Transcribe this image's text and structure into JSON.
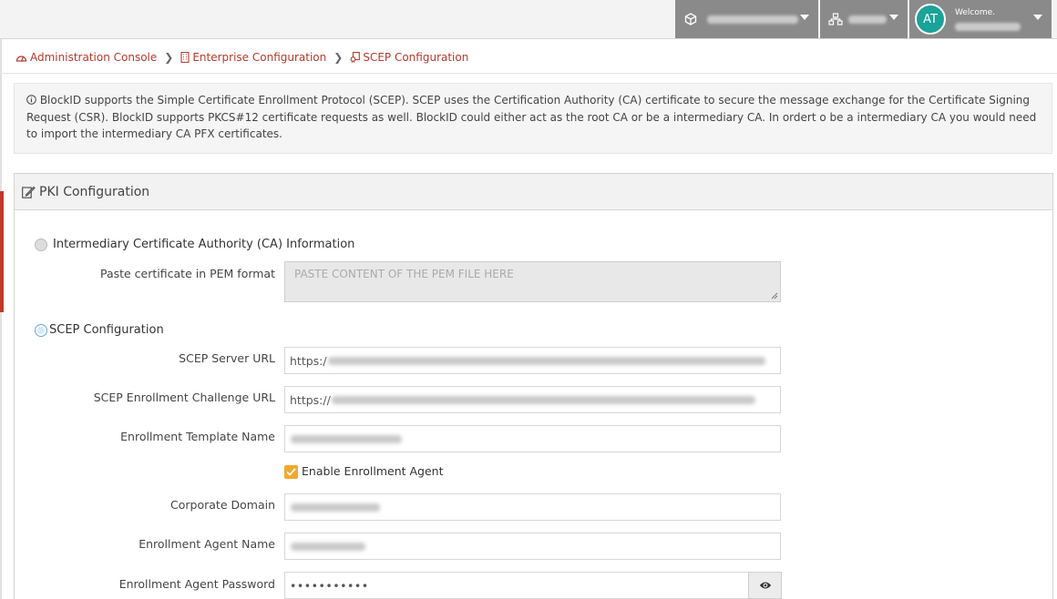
{
  "topbar": {
    "tenant_icon": "cube-icon",
    "network_icon": "network-icon",
    "avatar_initials": "AT",
    "welcome_label": "Welcome."
  },
  "breadcrumb": [
    {
      "label": "Administration Console",
      "icon": "dashboard-icon"
    },
    {
      "label": "Enterprise Configuration",
      "icon": "building-icon"
    },
    {
      "label": "SCEP Configuration",
      "icon": "certificate-icon"
    }
  ],
  "info": {
    "text": "BlockID supports the Simple Certificate Enrollment Protocol (SCEP). SCEP uses the Certification Authority (CA) certificate to secure the message exchange for the Certificate Signing Request (CSR). BlockID supports PKCS#12 certificate requests as well. BlockID could either act as the root CA or be a intermediary CA. In ordert o be a intermediary CA you would need to import the intermediary CA PFX certificates."
  },
  "panel": {
    "title": "PKI Configuration",
    "ca_option_label": "Intermediary Certificate Authority (CA) Information",
    "pem_label": "Paste certificate in PEM format",
    "pem_placeholder": "PASTE CONTENT OF THE PEM FILE HERE",
    "scep_option_label": "SCEP Configuration",
    "fields": {
      "server_url_label": "SCEP Server URL",
      "server_url_value": "https:/",
      "challenge_url_label": "SCEP Enrollment Challenge URL",
      "challenge_url_value": "https://",
      "template_label": "Enrollment Template Name",
      "enable_agent_label": "Enable Enrollment Agent",
      "domain_label": "Corporate Domain",
      "agent_name_label": "Enrollment Agent Name",
      "agent_password_label": "Enrollment Agent Password",
      "agent_password_value": "•••••••••••"
    }
  },
  "colors": {
    "accent_red": "#b33a2b",
    "checkbox_orange": "#f0a92e",
    "avatar_teal": "#1aa39a",
    "topbar_gray": "#8a8a8a"
  }
}
